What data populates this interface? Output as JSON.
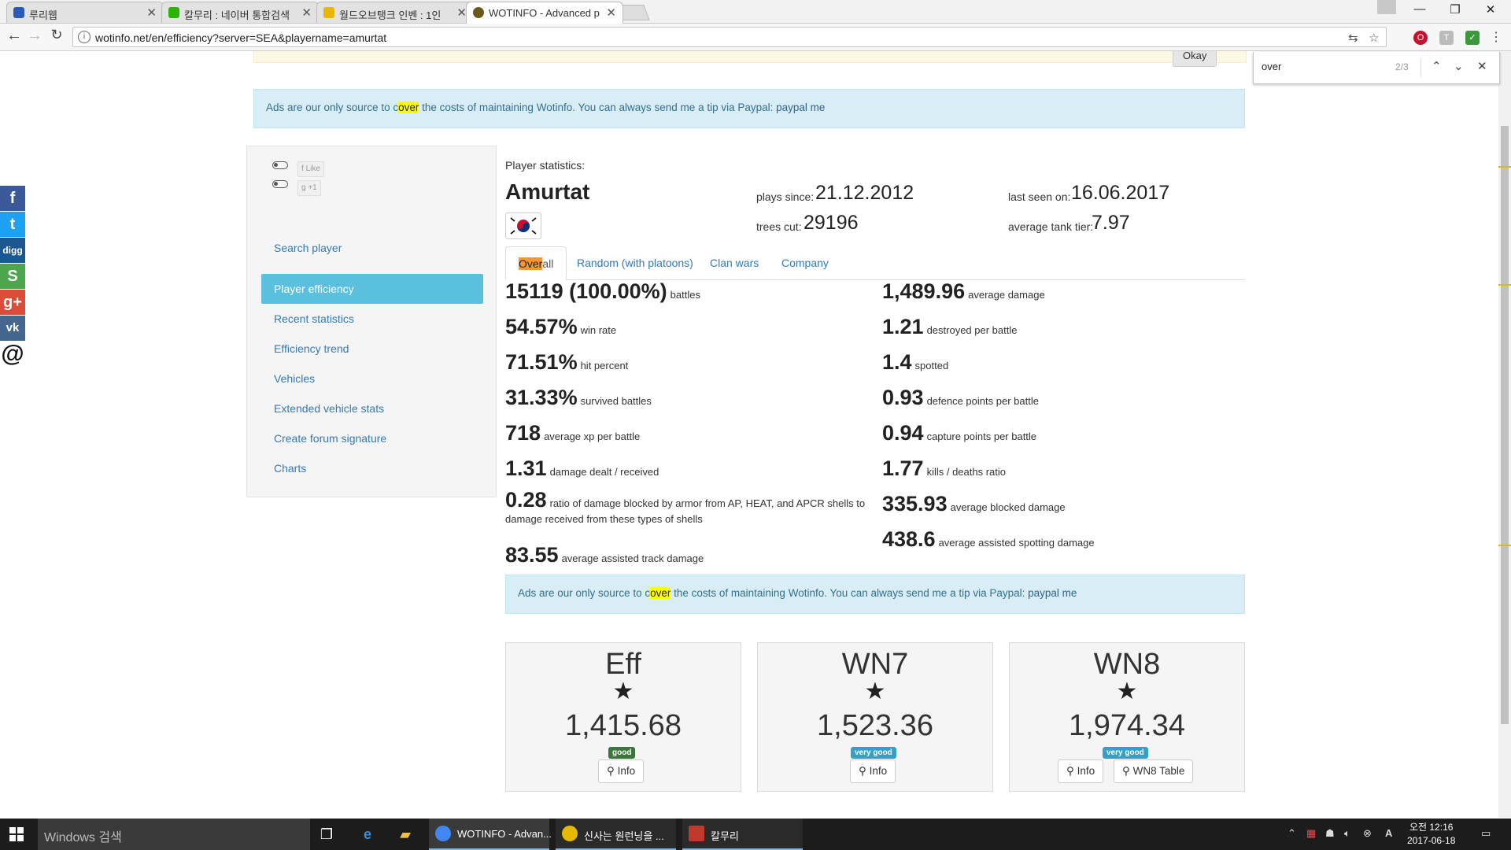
{
  "browser": {
    "tabs": [
      {
        "title": "루리웹",
        "color": "#2b5bb8"
      },
      {
        "title": "칼무리 : 네이버 통합검색",
        "color": "#2db400"
      },
      {
        "title": "월드오브탱크 인벤 : 1인",
        "color": "#e8b500"
      },
      {
        "title": "WOTINFO - Advanced p",
        "color": "#6b5a1e"
      }
    ],
    "url": "wotinfo.net/en/efficiency?server=SEA&playername=amurtat",
    "find": {
      "query": "over",
      "count": "2/3"
    }
  },
  "page": {
    "top_button": "Okay",
    "ad": {
      "before": "Ads are our only source to c",
      "highlight": "over",
      "after": " the costs of maintaining Wotinfo. You can always send me a tip via Paypal: ",
      "link": "paypal me"
    },
    "share_buttons": [
      {
        "label": "f",
        "color": "#3b5998"
      },
      {
        "label": "t",
        "color": "#1da1f2"
      },
      {
        "label": "digg",
        "color": "#1b5891"
      },
      {
        "label": "S",
        "color": "#4ca64c"
      },
      {
        "label": "g+",
        "color": "#dd4b39"
      },
      {
        "label": "vk",
        "color": "#45668e"
      },
      {
        "label": "@",
        "color": "#111111"
      }
    ],
    "social": {
      "like": "Like",
      "plus": "+1"
    },
    "sidebar": {
      "items": [
        {
          "label": "Search player"
        },
        {
          "label": "Player efficiency"
        },
        {
          "label": "Recent statistics"
        },
        {
          "label": "Efficiency trend"
        },
        {
          "label": "Vehicles"
        },
        {
          "label": "Extended vehicle stats"
        },
        {
          "label": "Create forum signature"
        },
        {
          "label": "Charts"
        }
      ]
    },
    "player": {
      "heading": "Player statistics:",
      "name": "Amurtat",
      "plays_since_label": "plays since:",
      "plays_since": "21.12.2012",
      "last_seen_label": "last seen on:",
      "last_seen": "16.06.2017",
      "trees_cut_label": "trees cut:",
      "trees_cut": "29196",
      "avg_tier_label": "average tank tier:",
      "avg_tier": "7.97"
    },
    "tabs": {
      "overall_hl": "Over",
      "overall_rest": "all",
      "others": [
        "Random (with platoons)",
        "Clan wars",
        "Company"
      ]
    },
    "stats_left": [
      {
        "value": "15119 (100.00%)",
        "label": "battles"
      },
      {
        "value": "54.57%",
        "label": "win rate"
      },
      {
        "value": "71.51%",
        "label": "hit percent"
      },
      {
        "value": "31.33%",
        "label": "survived battles"
      },
      {
        "value": "718",
        "label": "average xp per battle"
      },
      {
        "value": "1.31",
        "label": "damage dealt / received"
      },
      {
        "value": "0.28",
        "label": "ratio of damage blocked by armor from AP, HEAT, and APCR shells to damage received from these types of shells"
      },
      {
        "value": "83.55",
        "label": "average assisted track damage"
      }
    ],
    "stats_right": [
      {
        "value": "1,489.96",
        "label": "average damage"
      },
      {
        "value": "1.21",
        "label": "destroyed per battle"
      },
      {
        "value": "1.4",
        "label": "spotted"
      },
      {
        "value": "0.93",
        "label": "defence points per battle"
      },
      {
        "value": "0.94",
        "label": "capture points per battle"
      },
      {
        "value": "1.77",
        "label": "kills / deaths ratio"
      },
      {
        "value": "335.93",
        "label": "average blocked damage"
      },
      {
        "value": "438.6",
        "label": "average assisted spotting damage"
      }
    ],
    "ratings": [
      {
        "title": "Eff",
        "value": "1,415.68",
        "badge": "good",
        "badge_color": "#3c763d",
        "buttons": [
          "Info"
        ]
      },
      {
        "title": "WN7",
        "value": "1,523.36",
        "badge": "very good",
        "badge_color": "#31a2c7",
        "buttons": [
          "Info"
        ]
      },
      {
        "title": "WN8",
        "value": "1,974.34",
        "badge": "very good",
        "badge_color": "#31a2c7",
        "buttons": [
          "Info",
          "WN8 Table"
        ]
      }
    ]
  },
  "taskbar": {
    "search": "Windows 검색",
    "apps": [
      {
        "label": "WOTINFO - Advan...",
        "color": "#4285f4"
      },
      {
        "label": "신사는 원런닝을 ...",
        "color": "#e6b800"
      },
      {
        "label": "칼무리",
        "color": "#c0392b"
      }
    ],
    "clock_time": "오전 12:16",
    "clock_date": "2017-06-18",
    "lang": "A"
  }
}
